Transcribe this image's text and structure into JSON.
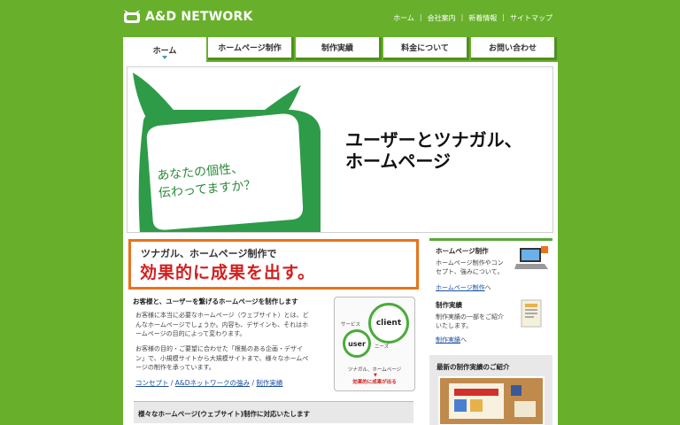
{
  "header": {
    "logo_text": "A&D NETWORK",
    "util_nav": [
      "ホーム",
      "会社案内",
      "新着情報",
      "サイトマップ"
    ]
  },
  "gnav": {
    "tabs": [
      {
        "label": "ホーム",
        "active": true
      },
      {
        "label": "ホームページ制作",
        "active": false
      },
      {
        "label": "制作実績",
        "active": false
      },
      {
        "label": "料金について",
        "active": false
      },
      {
        "label": "お問い合わせ",
        "active": false
      }
    ]
  },
  "hero": {
    "line1": "ユーザーとツナガル、",
    "line2": "ホームページ",
    "bubble_line1": "あなたの個性、",
    "bubble_line2": "伝わってますか？"
  },
  "catch": {
    "small": "ツナガル、ホームページ制作で",
    "big": "効果的に成果を出す。"
  },
  "intro": {
    "title": "お客様と、ユーザーを繋げるホームページを制作します",
    "p1_lines": [
      "お客様に本当に必要なホームページ（ウェブサイト）とは、ど",
      "んなホームページでしょうか。内容も、デザインも、それはホ",
      "ームページの目的によって変わります。"
    ],
    "p2_lines": [
      "お客様の目的・ご要望に合わせた「根拠のある企画・デザイ",
      "ン」で、小規模サイトから大規模サイトまで、様々なホームペ",
      "ージの制作を承っています。"
    ],
    "links": [
      "コンセプト",
      "A&Dネットワークの強み",
      "制作実績"
    ],
    "link_sep": " / "
  },
  "diagram": {
    "client": "client",
    "user": "user",
    "service": "サービス",
    "needs": "ニーズ",
    "caption1": "ツナガル、ホームページ",
    "caption2": "効果的に成果が出る"
  },
  "section": {
    "heading": "様々なホームページ(ウェブサイト)制作に対応いたします"
  },
  "sidebar": {
    "box1": {
      "title": "ホームページ制作",
      "text_lines": [
        "ホームページ制作やコン",
        "セプト、強みについて。"
      ],
      "link": "ホームページ制作",
      "link_suffix": "へ"
    },
    "box2": {
      "title": "制作実績",
      "text_lines": [
        "制作実績の一部をご紹介",
        "いたします。"
      ],
      "link": "制作実績",
      "link_suffix": "へ"
    },
    "works_title": "最新の制作実績のご紹介"
  },
  "colors": {
    "background": "#68b02c",
    "accent_orange": "#e8731a",
    "accent_red": "#d21f1f",
    "link_blue": "#1a4fa0",
    "mascot_green": "#2e9b48"
  }
}
